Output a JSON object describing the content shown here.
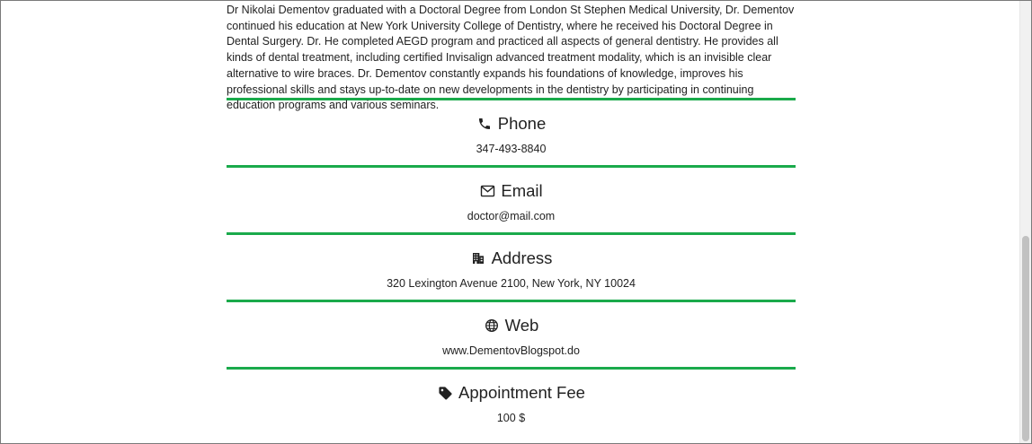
{
  "bio": "Dr Nikolai Dementov graduated with a Doctoral Degree from London St Stephen Medical University, Dr. Dementov continued his education at New York University College of Dentistry, where he received his Doctoral Degree in Dental Surgery. Dr. He completed AEGD program and practiced all aspects of general dentistry. He provides all kinds of dental treatment, including certified Invisalign advanced treatment modality, which is an invisible clear alternative to wire braces. Dr. Dementov constantly expands his foundations of knowledge, improves his professional skills and stays up-to-date on new developments in the dentistry by participating in continuing education programs and various seminars.",
  "sections": {
    "phone": {
      "icon": "phone-icon",
      "title": "Phone",
      "value": "347-493-8840"
    },
    "email": {
      "icon": "envelope-icon",
      "title": "Email",
      "value": "doctor@mail.com"
    },
    "address": {
      "icon": "building-icon",
      "title": "Address",
      "value": "320 Lexington Avenue 2100, New York, NY 10024"
    },
    "web": {
      "icon": "globe-icon",
      "title": "Web",
      "value": "www.DementovBlogspot.do"
    },
    "fee": {
      "icon": "tag-icon",
      "title": "Appointment Fee",
      "value": "100 $"
    }
  },
  "colors": {
    "divider": "#1aaa4b",
    "text": "#222222"
  }
}
